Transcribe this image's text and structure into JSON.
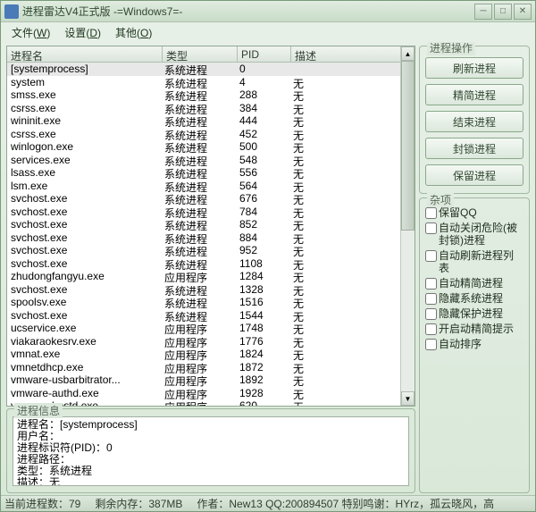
{
  "window": {
    "title": "进程雷达V4正式版 -=Windows7=-"
  },
  "menu": {
    "file": "文件(",
    "file_u": "W",
    "file_e": ")",
    "settings": "设置(",
    "settings_u": "D",
    "settings_e": ")",
    "other": "其他(",
    "other_u": "O",
    "other_e": ")"
  },
  "columns": {
    "name": "进程名",
    "type": "类型",
    "pid": "PID",
    "desc": "描述"
  },
  "processes": [
    {
      "name": "[systemprocess]",
      "type": "系统进程",
      "pid": "0",
      "desc": ""
    },
    {
      "name": "system",
      "type": "系统进程",
      "pid": "4",
      "desc": "无"
    },
    {
      "name": "smss.exe",
      "type": "系统进程",
      "pid": "288",
      "desc": "无"
    },
    {
      "name": "csrss.exe",
      "type": "系统进程",
      "pid": "384",
      "desc": "无"
    },
    {
      "name": "wininit.exe",
      "type": "系统进程",
      "pid": "444",
      "desc": "无"
    },
    {
      "name": "csrss.exe",
      "type": "系统进程",
      "pid": "452",
      "desc": "无"
    },
    {
      "name": "winlogon.exe",
      "type": "系统进程",
      "pid": "500",
      "desc": "无"
    },
    {
      "name": "services.exe",
      "type": "系统进程",
      "pid": "548",
      "desc": "无"
    },
    {
      "name": "lsass.exe",
      "type": "系统进程",
      "pid": "556",
      "desc": "无"
    },
    {
      "name": "lsm.exe",
      "type": "系统进程",
      "pid": "564",
      "desc": "无"
    },
    {
      "name": "svchost.exe",
      "type": "系统进程",
      "pid": "676",
      "desc": "无"
    },
    {
      "name": "svchost.exe",
      "type": "系统进程",
      "pid": "784",
      "desc": "无"
    },
    {
      "name": "svchost.exe",
      "type": "系统进程",
      "pid": "852",
      "desc": "无"
    },
    {
      "name": "svchost.exe",
      "type": "系统进程",
      "pid": "884",
      "desc": "无"
    },
    {
      "name": "svchost.exe",
      "type": "系统进程",
      "pid": "952",
      "desc": "无"
    },
    {
      "name": "svchost.exe",
      "type": "系统进程",
      "pid": "1108",
      "desc": "无"
    },
    {
      "name": "zhudongfangyu.exe",
      "type": "应用程序",
      "pid": "1284",
      "desc": "无"
    },
    {
      "name": "svchost.exe",
      "type": "系统进程",
      "pid": "1328",
      "desc": "无"
    },
    {
      "name": "spoolsv.exe",
      "type": "系统进程",
      "pid": "1516",
      "desc": "无"
    },
    {
      "name": "svchost.exe",
      "type": "系统进程",
      "pid": "1544",
      "desc": "无"
    },
    {
      "name": "ucservice.exe",
      "type": "应用程序",
      "pid": "1748",
      "desc": "无"
    },
    {
      "name": "viakaraokesrv.exe",
      "type": "应用程序",
      "pid": "1776",
      "desc": "无"
    },
    {
      "name": "vmnat.exe",
      "type": "应用程序",
      "pid": "1824",
      "desc": "无"
    },
    {
      "name": "vmnetdhcp.exe",
      "type": "应用程序",
      "pid": "1872",
      "desc": "无"
    },
    {
      "name": "vmware-usbarbitrator...",
      "type": "应用程序",
      "pid": "1892",
      "desc": "无"
    },
    {
      "name": "vmware-authd.exe",
      "type": "应用程序",
      "pid": "1928",
      "desc": "无"
    },
    {
      "name": "vmware-hostd.exe",
      "type": "应用程序",
      "pid": "620",
      "desc": "无"
    }
  ],
  "info_group_title": "进程信息",
  "info": {
    "l1": "进程名：[systemprocess]",
    "l2": "用户名：",
    "l3": "进程标识符(PID)：0",
    "l4": "进程路径：",
    "l5": "类型：系统进程",
    "l6": "描述：无"
  },
  "ops": {
    "title": "进程操作",
    "refresh": "刷新进程",
    "trim": "精简进程",
    "end": "结束进程",
    "block": "封锁进程",
    "keep": "保留进程"
  },
  "misc": {
    "title": "杂项",
    "keep_qq": "保留QQ",
    "auto_close_danger": "自动关闭危险(被封锁)进程",
    "auto_refresh": "自动刷新进程列表",
    "auto_trim": "自动精简进程",
    "hide_sys": "隐藏系统进程",
    "hide_protect": "隐藏保护进程",
    "enable_fine": "开启动精简提示",
    "auto_sort": "自动排序"
  },
  "status": {
    "count": "当前进程数：79",
    "mem": "剩余内存：387MB",
    "author": "作者：New13 QQ:200894507 特别鸣谢：HYrz，孤云晓风，高"
  }
}
